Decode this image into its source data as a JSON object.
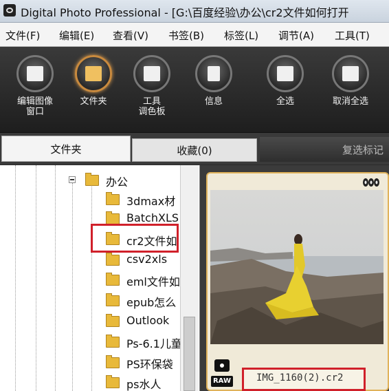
{
  "window": {
    "title": "Digital Photo Professional - [G:\\百度经验\\办公\\cr2文件如何打开"
  },
  "menu": [
    "文件(F)",
    "编辑(E)",
    "查看(V)",
    "书签(B)",
    "标签(L)",
    "调节(A)",
    "工具(T)"
  ],
  "toolbar": [
    {
      "label": "编辑图像\n窗口",
      "icon": "edit-image-icon"
    },
    {
      "label": "文件夹",
      "icon": "folder-icon",
      "active": true
    },
    {
      "label": "工具\n调色板",
      "icon": "tool-palette-icon"
    },
    {
      "label": "信息",
      "icon": "info-icon"
    },
    {
      "label": "全选",
      "icon": "select-all-icon"
    },
    {
      "label": "取消全选",
      "icon": "deselect-all-icon"
    }
  ],
  "tabs": {
    "folder": "文件夹",
    "bookmarks": "收藏(0)",
    "checkmark": "复选标记"
  },
  "tree": {
    "parent": "办公",
    "items": [
      "3dmax材",
      "BatchXLS",
      "cr2文件如",
      "csv2xls",
      "eml文件如",
      "epub怎么",
      "Outlook",
      "Ps-6.1儿童",
      "PS环保袋",
      "ps水人"
    ]
  },
  "thumbnail": {
    "filename": "IMG_1160(2).cr2",
    "badge": "RAW"
  },
  "colors": {
    "highlight": "#d0202a",
    "card_border": "#e0b25a",
    "accent": "#e0a050"
  }
}
